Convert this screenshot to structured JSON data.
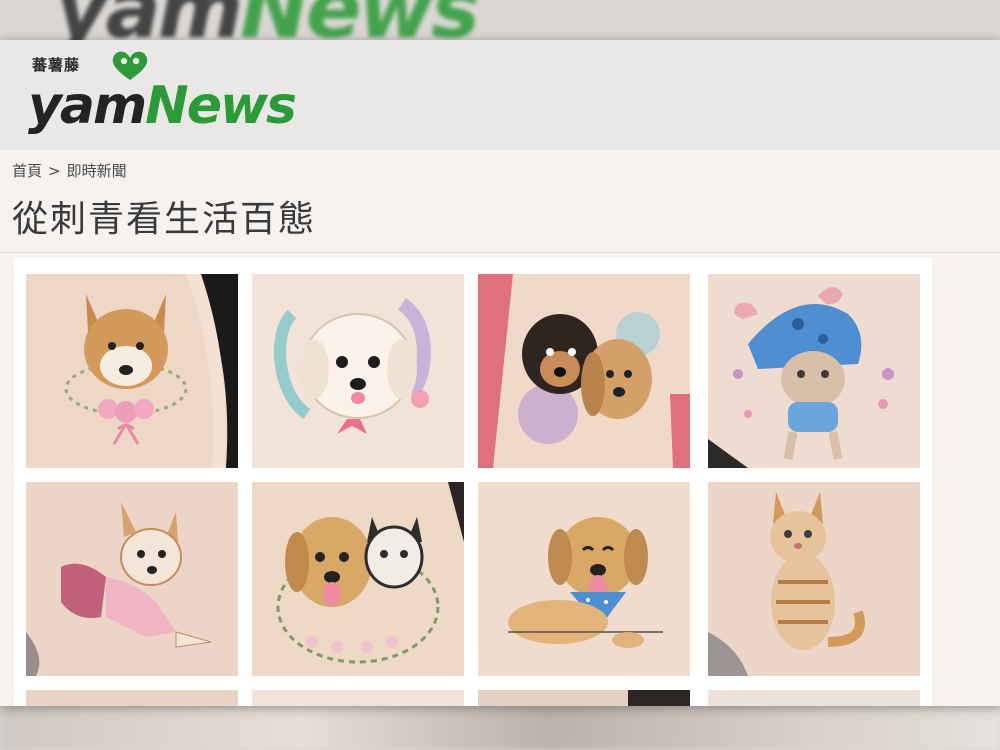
{
  "site": {
    "logo_cn": "蕃薯藤",
    "logo_yam": "yam",
    "logo_news": "News"
  },
  "breadcrumb": {
    "home": "首頁",
    "separator": ">",
    "section": "即時新聞"
  },
  "article": {
    "title": "從刺青看生活百態"
  },
  "colors": {
    "brand_green": "#2b9b38",
    "brand_dark": "#232323",
    "masthead_bg": "#e9e8e7",
    "page_bg": "#f6f2f0"
  },
  "gallery": {
    "images": [
      {
        "subject": "shiba-floral-tattoo"
      },
      {
        "subject": "poodle-watercolor-tattoo"
      },
      {
        "subject": "two-dogs-watercolor-tattoo"
      },
      {
        "subject": "cat-blue-hat-tattoo"
      },
      {
        "subject": "dog-pink-dress-tattoo"
      },
      {
        "subject": "golden-retriever-cat-wreath-tattoo"
      },
      {
        "subject": "golden-retriever-bandana-tattoo"
      },
      {
        "subject": "tabby-cat-tattoo"
      }
    ]
  }
}
